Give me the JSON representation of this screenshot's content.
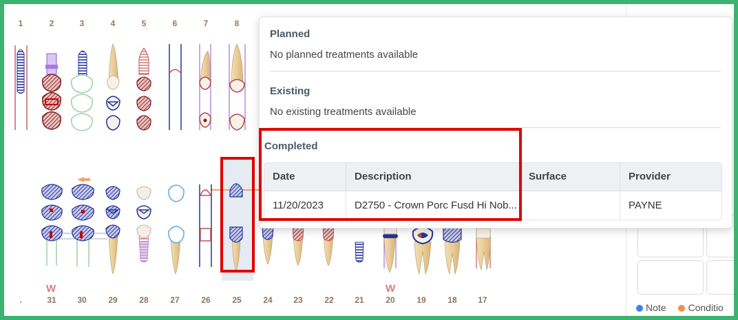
{
  "chart": {
    "upper_numbers": [
      "1",
      "2",
      "3",
      "4",
      "5",
      "6",
      "7",
      "8"
    ],
    "lower_numbers": [
      ".",
      "31",
      "30",
      "29",
      "28",
      "27",
      "26",
      "25",
      "24",
      "23",
      "22",
      "21",
      "20",
      "19",
      "18",
      "17"
    ],
    "w_marks": [
      "W",
      "W"
    ]
  },
  "popover": {
    "planned_title": "Planned",
    "planned_text": "No planned treatments available",
    "existing_title": "Existing",
    "existing_text": "No existing treatments available",
    "completed_title": "Completed",
    "columns": [
      "Date",
      "Description",
      "Surface",
      "Provider"
    ],
    "rows": [
      {
        "date": "11/20/2023",
        "description": "D2750 - Crown Porc Fusd Hi Nob...",
        "surface": "",
        "provider": "PAYNE"
      }
    ]
  },
  "legend": {
    "note_label": "Note",
    "note_color": "#3b82f6",
    "condition_label": "Conditio",
    "condition_color": "#f0914a"
  },
  "colors": {
    "frame_border": "#3cb371",
    "highlight": "#e00000",
    "selected_column": "#e6ebf3"
  }
}
